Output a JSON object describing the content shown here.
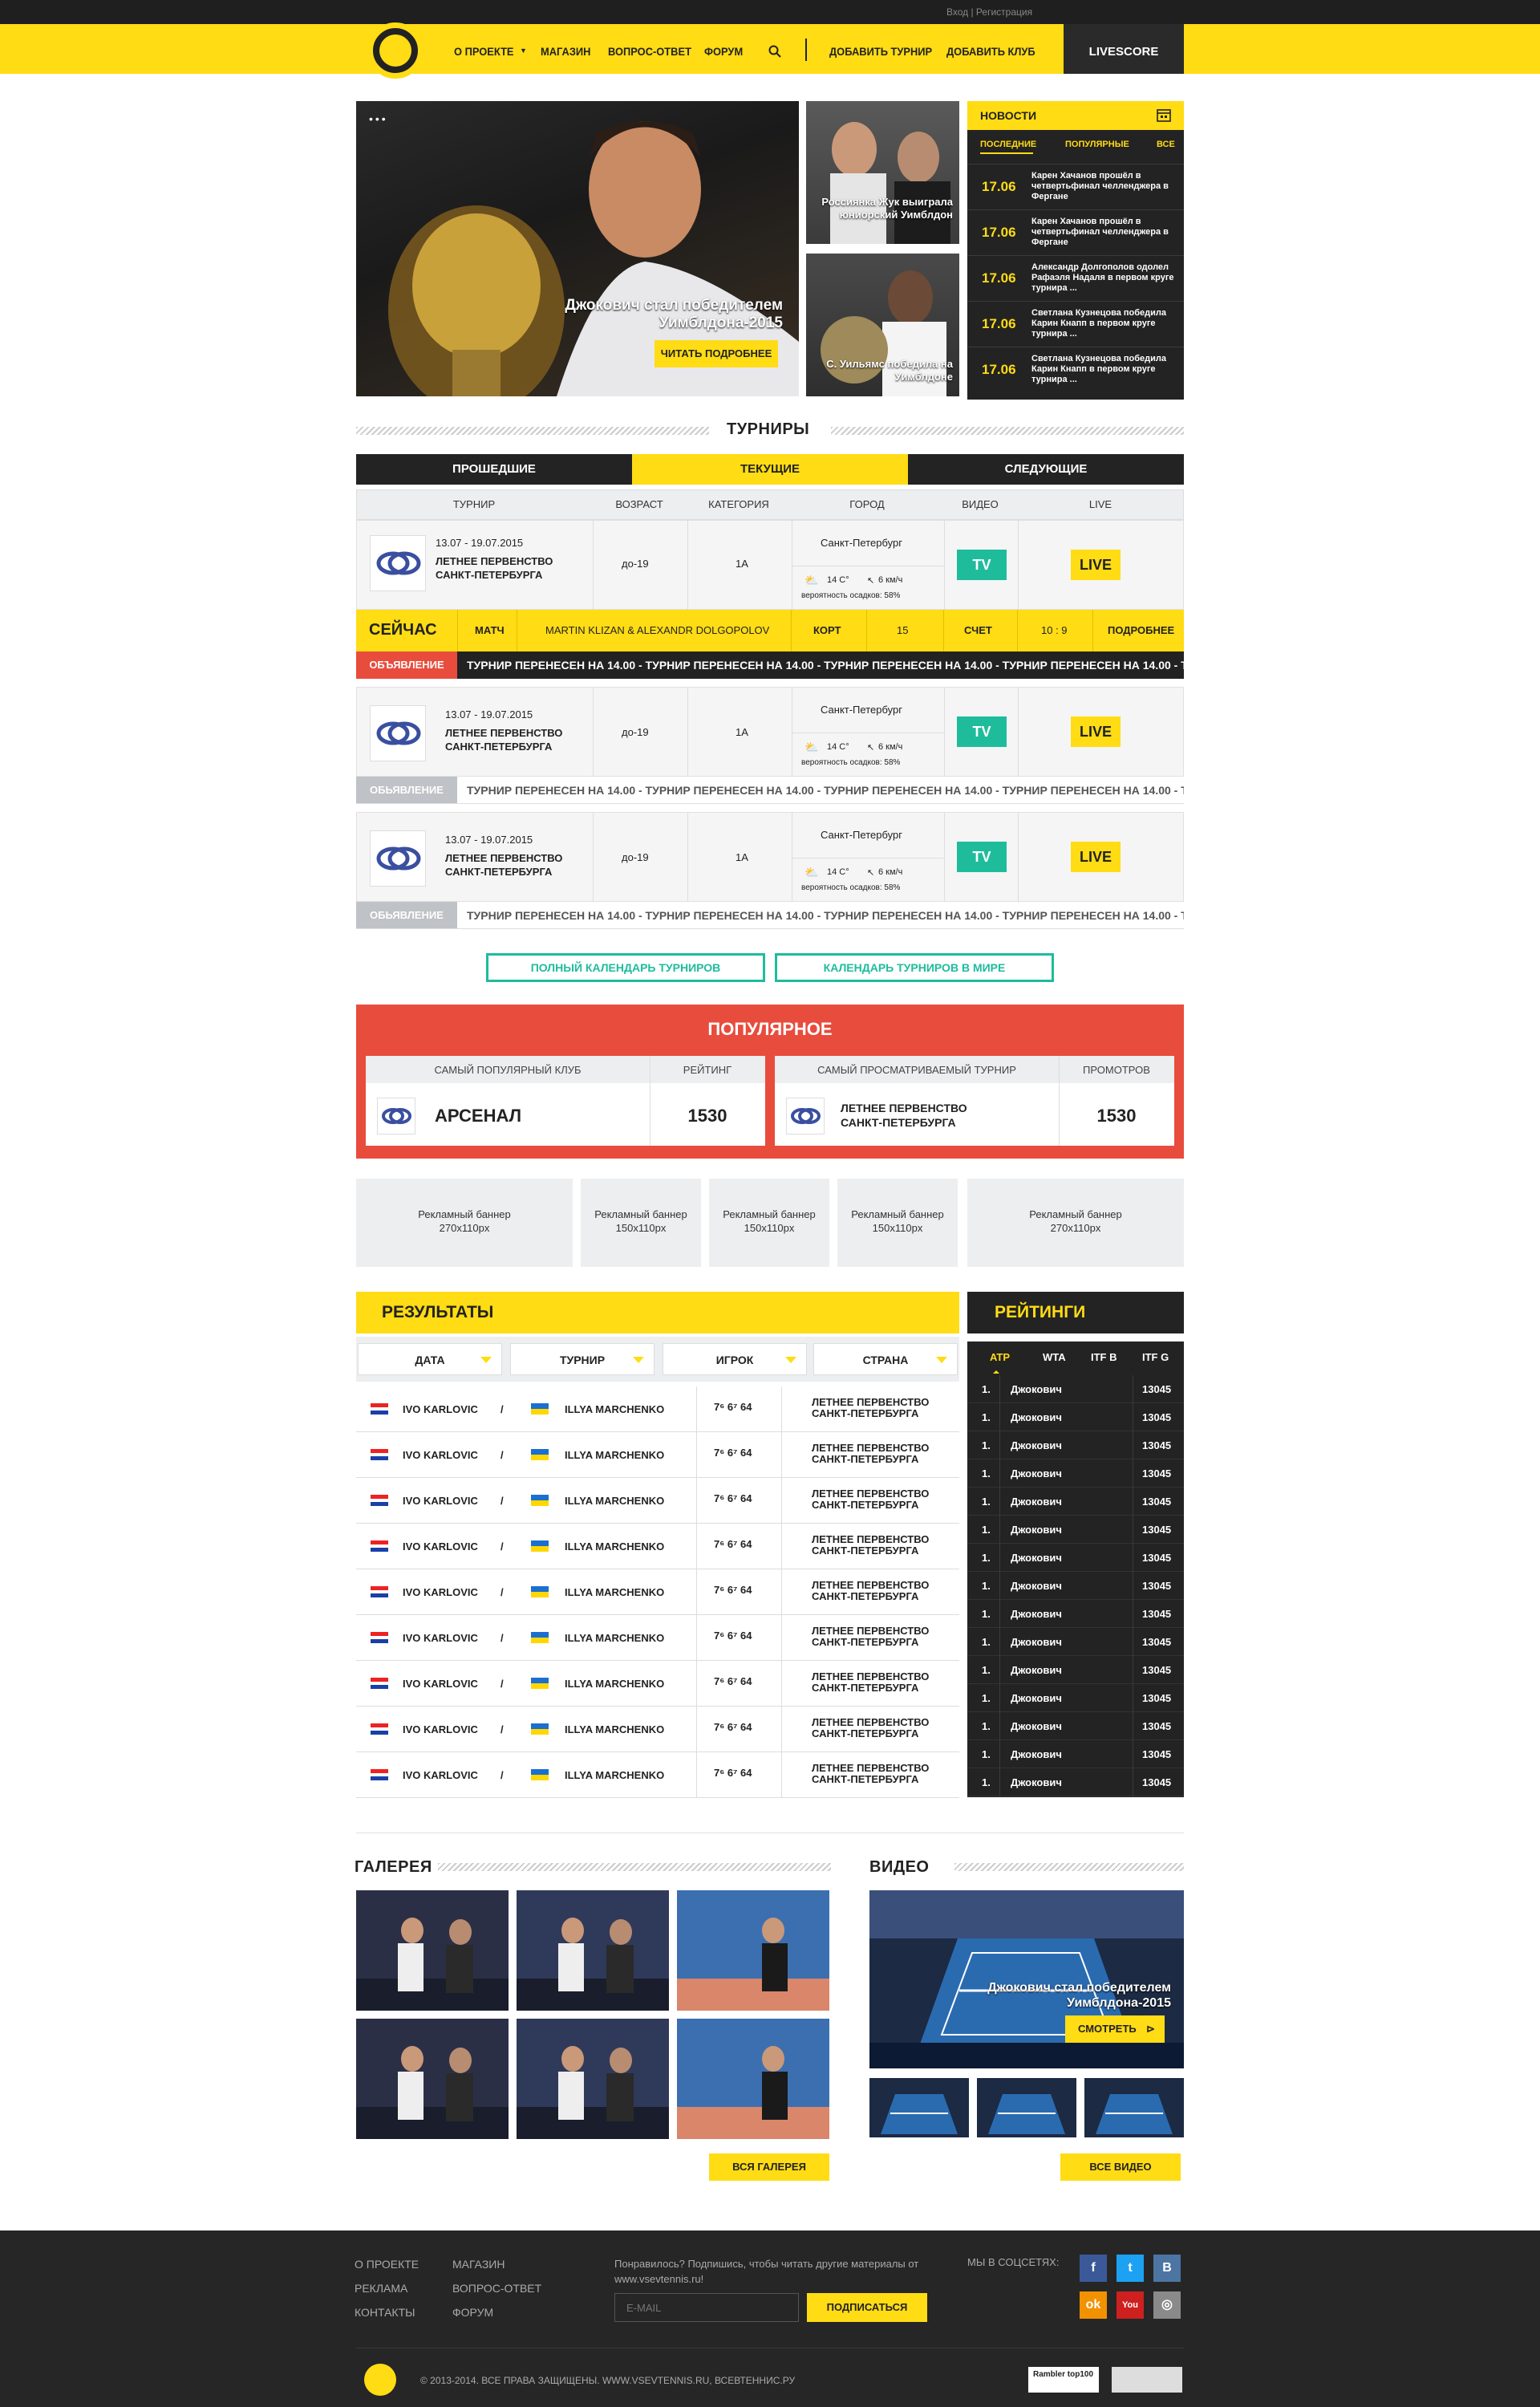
{
  "topbar": {
    "login": "Вход | Регистрация"
  },
  "nav": {
    "items": [
      "О ПРОЕКТЕ",
      "МАГАЗИН",
      "ВОПРОС-ОТВЕТ",
      "ФОРУМ"
    ],
    "actions": [
      "ДОБАВИТЬ ТУРНИР",
      "ДОБАВИТЬ КЛУБ"
    ],
    "livescore": "LIVESCORE"
  },
  "hero": {
    "main_caption": "Джокович стал победителем Уимблдона-2015",
    "main_button": "ЧИТАТЬ ПОДРОБНЕЕ",
    "side1_caption": "Россиянка Жук выиграла юниорский Уимблдон",
    "side2_caption": "С. Уильямс победила на Уимблдоне"
  },
  "news": {
    "title": "НОВОСТИ",
    "tabs": [
      "ПОСЛЕДНИЕ",
      "ПОПУЛЯРНЫЕ",
      "ВСЕ"
    ],
    "items": [
      {
        "date": "17.06",
        "text": "Карен Хачанов прошёл в четвертьфинал челленджера в Фергане"
      },
      {
        "date": "17.06",
        "text": "Карен Хачанов прошёл в четвертьфинал челленджера в Фергане"
      },
      {
        "date": "17.06",
        "text": "Александр Долгополов одолел Рафаэля Надаля в первом круге турнира ..."
      },
      {
        "date": "17.06",
        "text": "Светлана Кузнецова победила Карин Кнапп в первом круге турнира ..."
      },
      {
        "date": "17.06",
        "text": "Светлана Кузнецова победила Карин Кнапп в первом круге турнира ..."
      }
    ]
  },
  "tournaments": {
    "title": "ТУРНИРЫ",
    "tabs": [
      "ПРОШЕДШИЕ",
      "ТЕКУЩИЕ",
      "СЛЕДУЮЩИЕ"
    ],
    "columns": [
      "ТУРНИР",
      "ВОЗРАСТ",
      "КАТЕГОРИЯ",
      "ГОРОД",
      "ВИДЕО",
      "LIVE"
    ],
    "rows": [
      {
        "dates": "13.07 - 19.07.2015",
        "name": "ЛЕТНЕЕ ПЕРВЕНСТВО САНКТ-ПЕТЕРБУРГА",
        "age": "до-19",
        "category": "1А",
        "city": "Санкт-Петербург",
        "temp": "14 C°",
        "wind": "6 км/ч",
        "rain": "вероятность осадков: 58%",
        "tv": "TV",
        "live": "LIVE"
      },
      {
        "dates": "13.07 - 19.07.2015",
        "name": "ЛЕТНЕЕ ПЕРВЕНСТВО САНКТ-ПЕТЕРБУРГА",
        "age": "до-19",
        "category": "1А",
        "city": "Санкт-Петербург",
        "temp": "14 C°",
        "wind": "6 км/ч",
        "rain": "вероятность осадков: 58%",
        "tv": "TV",
        "live": "LIVE"
      },
      {
        "dates": "13.07 - 19.07.2015",
        "name": "ЛЕТНЕЕ ПЕРВЕНСТВО САНКТ-ПЕТЕРБУРГА",
        "age": "до-19",
        "category": "1А",
        "city": "Санкт-Петербург",
        "temp": "14 C°",
        "wind": "6 км/ч",
        "rain": "вероятность осадков: 58%",
        "tv": "TV",
        "live": "LIVE"
      }
    ],
    "now": {
      "label": "СЕЙЧАС",
      "match_label": "МАТЧ",
      "match": "MARTIN KLIZAN & ALEXANDR DOLGOPOLOV",
      "court_label": "КОРТ",
      "court": "15",
      "score_label": "СЧЕТ",
      "score": "10 : 9",
      "more": "ПОДРОБНЕЕ"
    },
    "announce_label": "ОБЪЯВЛЕНИЕ",
    "announce_label_gray": "ОБЬЯВЛЕНИЕ",
    "announce_text": "ТУРНИР ПЕРЕНЕСЕН НА 14.00 - ТУРНИР ПЕРЕНЕСЕН НА 14.00 - ТУРНИР ПЕРЕНЕСЕН НА 14.00 - ТУРНИР ПЕРЕНЕСЕН НА 14.00 - ТУРНИР ПЕРЕНЕСЕН НА 14.00 - ТУРНИР П",
    "btn_calendar": "ПОЛНЫЙ КАЛЕНДАРЬ ТУРНИРОВ",
    "btn_world": "КАЛЕНДАРЬ ТУРНИРОВ В МИРЕ"
  },
  "popular": {
    "title": "ПОПУЛЯРНОЕ",
    "club_head": "САМЫЙ ПОПУЛЯРНЫЙ КЛУБ",
    "rating_head": "РЕЙТИНГ",
    "club_name": "АРСЕНАЛ",
    "club_rating": "1530",
    "tour_head": "САМЫЙ ПРОСМАТРИВАЕМЫЙ ТУРНИР",
    "views_head": "ПРОМОТРОВ",
    "tour_name": "ЛЕТНЕЕ ПЕРВЕНСТВО САНКТ-ПЕТЕРБУРГА",
    "tour_views": "1530"
  },
  "banners": [
    {
      "line1": "Рекламный баннер",
      "line2": "270х110px"
    },
    {
      "line1": "Рекламный баннер",
      "line2": "150х110px"
    },
    {
      "line1": "Рекламный баннер",
      "line2": "150х110px"
    },
    {
      "line1": "Рекламный баннер",
      "line2": "150х110px"
    },
    {
      "line1": "Рекламный баннер",
      "line2": "270х110px"
    }
  ],
  "results": {
    "title": "РЕЗУЛЬТАТЫ",
    "filters": [
      "ДАТА",
      "ТУРНИР",
      "ИГРОК",
      "СТРАНА"
    ],
    "row": {
      "p1": "IVO KARLOVIC",
      "sep": "/",
      "p2": "ILLYA MARCHENKO",
      "score": "7⁶ 6⁷ 64",
      "tour": "ЛЕТНЕЕ ПЕРВЕНСТВО САНКТ-ПЕТЕРБУРГА"
    }
  },
  "ratings": {
    "title": "РЕЙТИНГИ",
    "tabs": [
      "ATP",
      "WTA",
      "ITF B",
      "ITF G"
    ],
    "row": {
      "rank": "1.",
      "name": "Джокович",
      "points": "13045"
    }
  },
  "gallery": {
    "title": "ГАЛЕРЕЯ",
    "button": "ВСЯ ГАЛЕРЕЯ"
  },
  "video": {
    "title": "ВИДЕО",
    "caption": "Джокович стал победителем Уимблдона-2015",
    "watch": "СМОТРЕТЬ",
    "button": "ВСЕ ВИДЕО"
  },
  "footer": {
    "col1": [
      "О ПРОЕКТЕ",
      "РЕКЛАМА",
      "КОНТАКТЫ"
    ],
    "col2": [
      "МАГАЗИН",
      "ВОПРОС-ОТВЕТ",
      "ФОРУМ"
    ],
    "subscribe_text": "Понравилось? Подпишись, чтобы читать другие материалы от www.vsevtennis.ru!",
    "email_placeholder": "E-MAIL",
    "subscribe_button": "ПОДПИСАТЬСЯ",
    "social_label": "МЫ В СОЦСЕТЯХ:",
    "copyright": "© 2013-2014. ВСЕ ПРАВА ЗАЩИЩЕНЫ. WWW.VSEVTENNIS.RU, ВСЕВТЕННИС.РУ",
    "counter1": "Rambler top100"
  }
}
